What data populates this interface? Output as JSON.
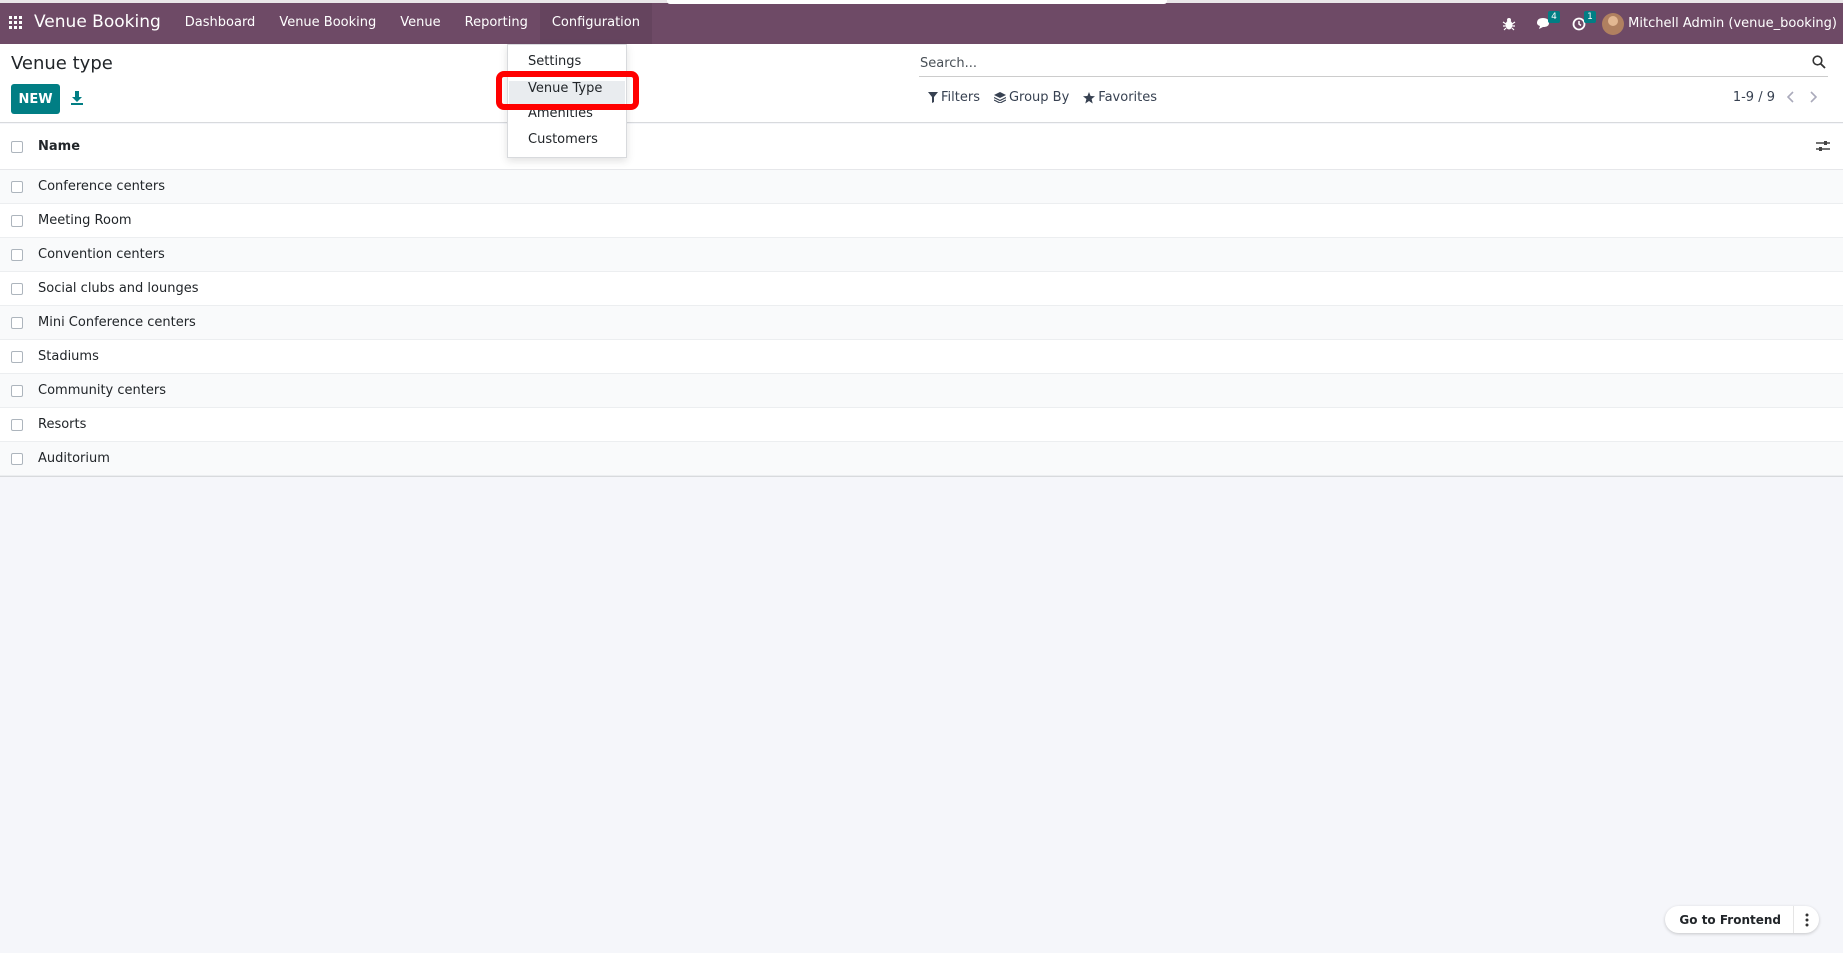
{
  "navbar": {
    "brand": "Venue Booking",
    "menu": [
      "Dashboard",
      "Venue Booking",
      "Venue",
      "Reporting",
      "Configuration"
    ],
    "messages_count": "4",
    "activities_count": "1",
    "user": "Mitchell Admin (venue_booking)",
    "bg_color": "#6e4a66"
  },
  "control": {
    "title": "Venue type",
    "new_label": "NEW",
    "search_placeholder": "Search...",
    "filters": "Filters",
    "group_by": "Group By",
    "favorites": "Favorites",
    "pager": "1-9 / 9",
    "accent": "#017e84"
  },
  "list": {
    "column_name": "Name",
    "rows": [
      "Conference centers",
      "Meeting Room",
      "Convention centers",
      "Social clubs and lounges",
      "Mini Conference centers",
      "Stadiums",
      "Community centers",
      "Resorts",
      "Auditorium"
    ]
  },
  "dropdown": {
    "items": [
      "Settings",
      "Venue Type",
      "Amenities",
      "Customers"
    ],
    "highlight_color": "#ff0000"
  },
  "frontend": {
    "label": "Go to Frontend"
  },
  "icons": [
    "apps-icon",
    "bug-icon",
    "chat-icon",
    "clock-icon",
    "download-icon",
    "search-icon",
    "filter-icon",
    "layers-icon",
    "star-icon",
    "chevron-left-icon",
    "chevron-right-icon",
    "settings-sliders-icon",
    "kebab-icon"
  ]
}
